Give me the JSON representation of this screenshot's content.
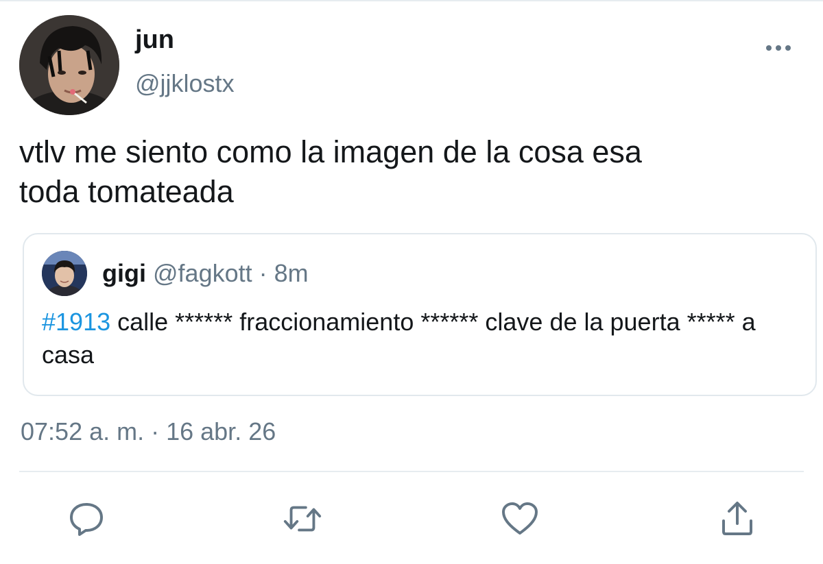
{
  "tweet": {
    "author": {
      "display_name": "jun",
      "handle": "@jjklostx",
      "avatar_icon": "user-avatar"
    },
    "text": "vtlv me siento como la imagen de la cosa esa\ntoda tomateada",
    "timestamp": "07:52 a. m. · 16 abr. 26",
    "more_icon": "more-horizontal-icon"
  },
  "quoted_tweet": {
    "display_name": "gigi",
    "handle": "@fagkott",
    "separator": "·",
    "time": "8m",
    "hashtag": "#1913",
    "text_rest": " calle ****** fraccionamiento ****** clave de la puerta ***** a casa"
  },
  "actions": [
    {
      "name": "reply",
      "icon": "reply-icon"
    },
    {
      "name": "retweet",
      "icon": "retweet-icon"
    },
    {
      "name": "like",
      "icon": "heart-icon"
    },
    {
      "name": "share",
      "icon": "share-icon"
    }
  ],
  "colors": {
    "text": "#14171a",
    "secondary": "#657786",
    "link": "#1b95e0",
    "border": "#e1e8ed",
    "icon": "#657786"
  }
}
